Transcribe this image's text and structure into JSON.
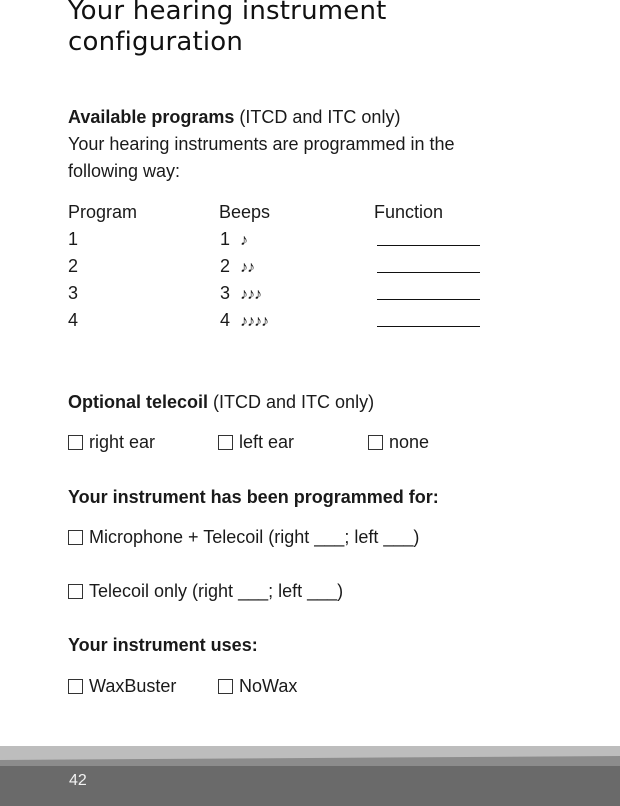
{
  "title_line1": "Your hearing instrument",
  "title_line2": "configuration",
  "programs": {
    "heading": "Available programs",
    "heading_note": " (ITCD and ITC only)",
    "intro_line1": "Your hearing instruments are programmed in the",
    "intro_line2": "following way:",
    "columns": [
      "Program",
      "Beeps",
      "Function"
    ],
    "rows": [
      {
        "program": "1",
        "beeps": "1",
        "notes": "♪"
      },
      {
        "program": "2",
        "beeps": "2",
        "notes": "♪♪"
      },
      {
        "program": "3",
        "beeps": "3",
        "notes": "♪♪♪"
      },
      {
        "program": "4",
        "beeps": "4",
        "notes": "♪♪♪♪"
      }
    ]
  },
  "telecoil": {
    "heading": "Optional telecoil",
    "heading_note": " (ITCD and ITC only)",
    "options": [
      "right ear",
      "left ear",
      "none"
    ]
  },
  "programmed_for": {
    "heading": "Your instrument has been programmed for:",
    "options": [
      "Microphone + Telecoil (right ___; left ___)",
      "Telecoil only (right ___; left ___)"
    ]
  },
  "uses": {
    "heading": "Your instrument uses:",
    "options": [
      "WaxBuster",
      "NoWax"
    ]
  },
  "page_number": "42"
}
